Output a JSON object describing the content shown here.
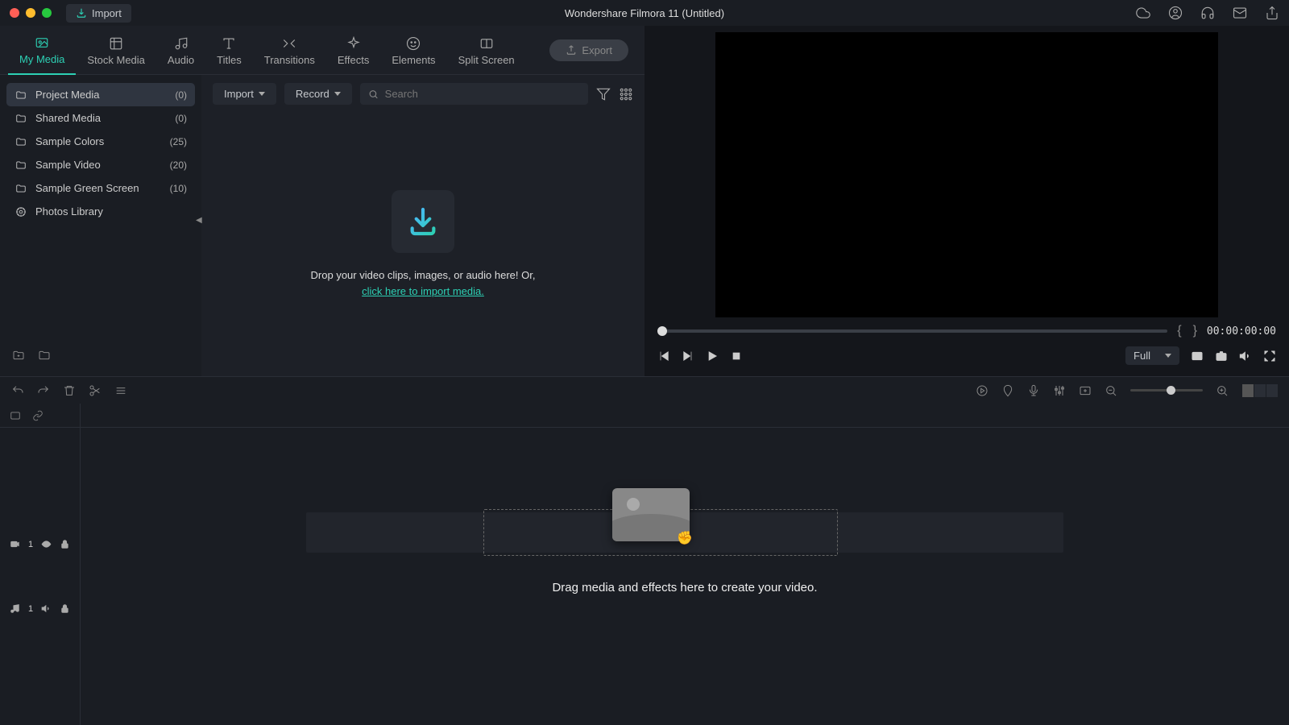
{
  "titlebar": {
    "import_label": "Import",
    "title": "Wondershare Filmora 11 (Untitled)"
  },
  "tabs": [
    {
      "label": "My Media"
    },
    {
      "label": "Stock Media"
    },
    {
      "label": "Audio"
    },
    {
      "label": "Titles"
    },
    {
      "label": "Transitions"
    },
    {
      "label": "Effects"
    },
    {
      "label": "Elements"
    },
    {
      "label": "Split Screen"
    }
  ],
  "export_label": "Export",
  "sidebar": {
    "items": [
      {
        "label": "Project Media",
        "count": "(0)"
      },
      {
        "label": "Shared Media",
        "count": "(0)"
      },
      {
        "label": "Sample Colors",
        "count": "(25)"
      },
      {
        "label": "Sample Video",
        "count": "(20)"
      },
      {
        "label": "Sample Green Screen",
        "count": "(10)"
      },
      {
        "label": "Photos Library",
        "count": ""
      }
    ]
  },
  "media_toolbar": {
    "import_label": "Import",
    "record_label": "Record",
    "search_placeholder": "Search"
  },
  "drop": {
    "line1": "Drop your video clips, images, or audio here! Or,",
    "link": "click here to import media."
  },
  "preview": {
    "timecode": "00:00:00:00",
    "quality": "Full",
    "mark_in": "{",
    "mark_out": "}"
  },
  "timeline": {
    "video_track_label": "1",
    "audio_track_label": "1",
    "hint": "Drag media and effects here to create your video."
  }
}
